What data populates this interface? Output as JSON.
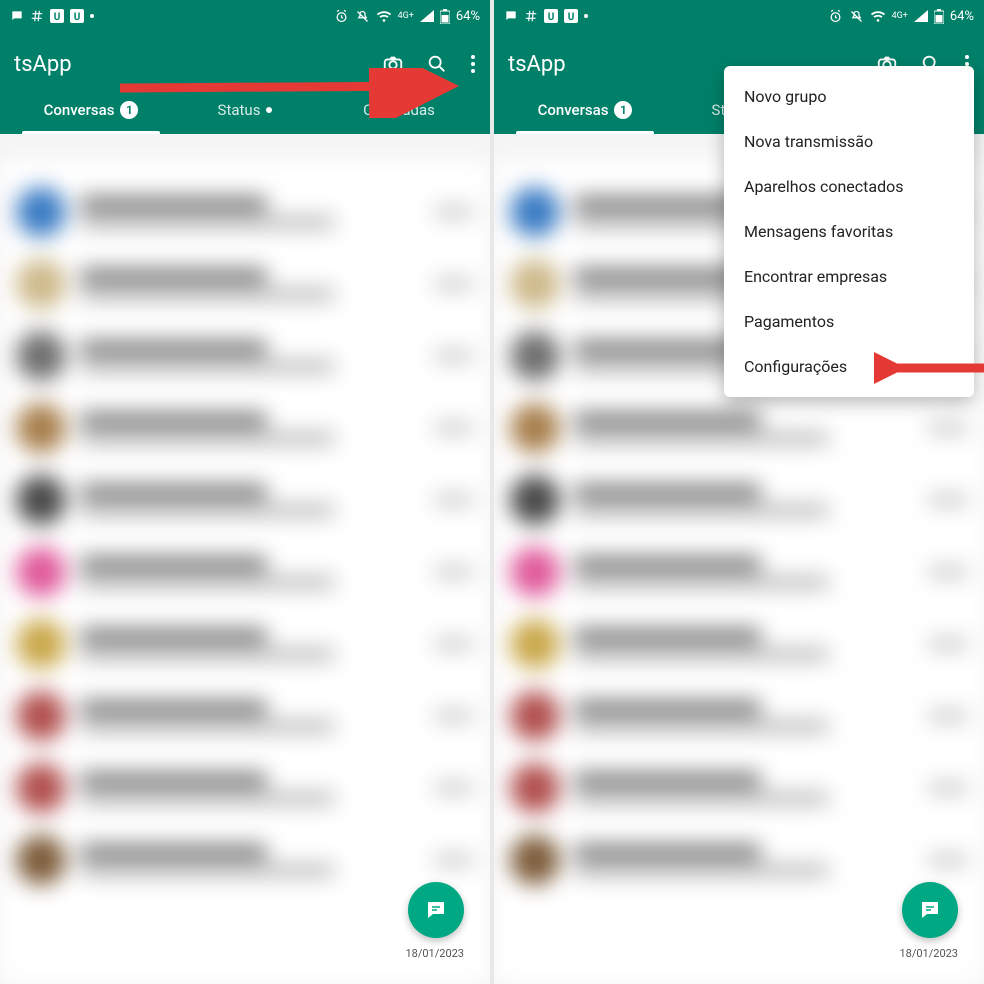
{
  "common": {
    "app_title": "tsApp",
    "battery": "64%",
    "network_label": "4G+",
    "tabs": {
      "conversas": "Conversas",
      "status": "Status",
      "chamadas": "Chamadas"
    },
    "unread_badge": "1",
    "timestamp": "18/01/2023"
  },
  "menu": {
    "items": [
      "Novo grupo",
      "Nova transmissão",
      "Aparelhos conectados",
      "Mensagens favoritas",
      "Encontrar empresas",
      "Pagamentos",
      "Configurações"
    ]
  },
  "avatar_colors": [
    "#3b7cc4",
    "#cdb98b",
    "#6f6f6f",
    "#a87f4d",
    "#4a4a4a",
    "#e05a9b",
    "#caa84b",
    "#b24f4f",
    "#b24f4f",
    "#7d5c3a"
  ],
  "colors": {
    "primary": "#008069",
    "accent": "#00a884",
    "arrow": "#e53935"
  }
}
